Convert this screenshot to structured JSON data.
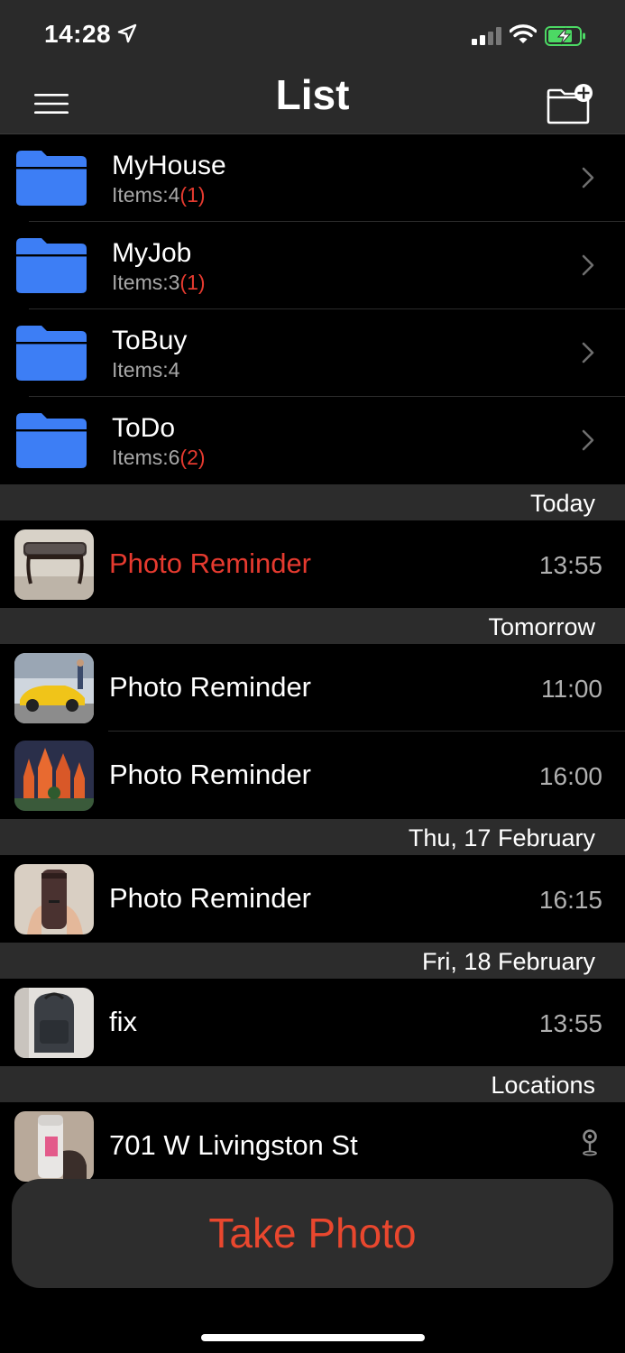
{
  "status": {
    "time": "14:28"
  },
  "nav": {
    "title": "List"
  },
  "folders": [
    {
      "name": "MyHouse",
      "count_label": "Items:4",
      "badge": "(1)"
    },
    {
      "name": "MyJob",
      "count_label": "Items:3",
      "badge": "(1)"
    },
    {
      "name": "ToBuy",
      "count_label": "Items:4",
      "badge": ""
    },
    {
      "name": "ToDo",
      "count_label": "Items:6",
      "badge": "(2)"
    }
  ],
  "sections": {
    "today": "Today",
    "tomorrow": "Tomorrow",
    "thu": "Thu, 17 February",
    "fri": "Fri, 18 February",
    "locations": "Locations"
  },
  "reminders": {
    "today_1": {
      "title": "Photo Reminder",
      "time": "13:55"
    },
    "tomorrow_1": {
      "title": "Photo Reminder",
      "time": "11:00"
    },
    "tomorrow_2": {
      "title": "Photo Reminder",
      "time": "16:00"
    },
    "thu_1": {
      "title": "Photo Reminder",
      "time": "16:15"
    },
    "fri_1": {
      "title": "fix",
      "time": "13:55"
    },
    "loc_1": {
      "title": "701 W Livingston St"
    }
  },
  "actions": {
    "take_photo": "Take Photo"
  },
  "colors": {
    "accent_red": "#e53a2f",
    "folder_blue": "#3d7ef5",
    "battery_green": "#4cd964"
  }
}
